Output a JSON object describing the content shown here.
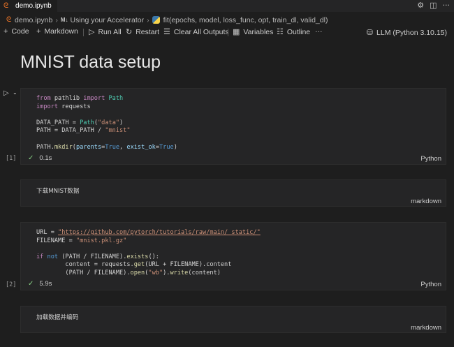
{
  "tab": {
    "title": "demo.ipynb",
    "close_icon": "×"
  },
  "breadcrumb": {
    "file": "demo.ipynb",
    "section": "Using your Accelerator",
    "section_prefix": "M↓",
    "symbol": "fit(epochs, model, loss_func, opt, train_dl, valid_dl)"
  },
  "toolbar": {
    "code": "Code",
    "markdown": "Markdown",
    "run_all": "Run All",
    "restart": "Restart",
    "clear_all_outputs": "Clear All Outputs",
    "variables": "Variables",
    "outline": "Outline",
    "more": "···",
    "kernel": "LLM (Python 3.10.15)"
  },
  "heading": "MNIST data setup",
  "cells": [
    {
      "type": "code",
      "exec_count": "[1]",
      "status": "0.1s",
      "language": "Python"
    },
    {
      "type": "markdown",
      "text": "下载MNIST数据",
      "language": "markdown"
    },
    {
      "type": "code",
      "exec_count": "[2]",
      "status": "5.9s",
      "language": "Python"
    },
    {
      "type": "markdown",
      "text": "加载数据并编码",
      "language": "markdown"
    }
  ],
  "code1": {
    "l1a": "from",
    "l1b": " pathlib ",
    "l1c": "import",
    "l1d": " Path",
    "l2a": "import",
    "l2b": " requests",
    "l3a": "DATA_PATH",
    "l3b": " = ",
    "l3c": "Path",
    "l3d": "(",
    "l3e": "\"data\"",
    "l3f": ")",
    "l4a": "PATH",
    "l4b": " = DATA_PATH / ",
    "l4c": "\"mnist\"",
    "l5a": "PATH.",
    "l5b": "mkdir",
    "l5c": "(",
    "l5d": "parents",
    "l5e": "=",
    "l5f": "True",
    "l5g": ", ",
    "l5h": "exist_ok",
    "l5i": "=",
    "l5j": "True",
    "l5k": ")"
  },
  "code2": {
    "l1a": "URL",
    "l1b": " = ",
    "l1c": "\"https://github.com/pytorch/tutorials/raw/main/_static/\"",
    "l2a": "FILENAME",
    "l2b": " = ",
    "l2c": "\"mnist.pkl.gz\"",
    "l3a": "if",
    "l3b": " ",
    "l3c": "not",
    "l3d": " (PATH / FILENAME).",
    "l3e": "exists",
    "l3f": "():",
    "l4a": "        content",
    "l4b": " = requests.",
    "l4c": "get",
    "l4d": "(URL + FILENAME).content",
    "l5a": "        (PATH / FILENAME).",
    "l5b": "open",
    "l5c": "(",
    "l5d": "\"wb\"",
    "l5e": ").",
    "l5f": "write",
    "l5g": "(content)"
  },
  "colors": {
    "background": "#1e1e1e",
    "cell": "#252526",
    "check": "#89d185",
    "jupyter": "#f37726"
  }
}
